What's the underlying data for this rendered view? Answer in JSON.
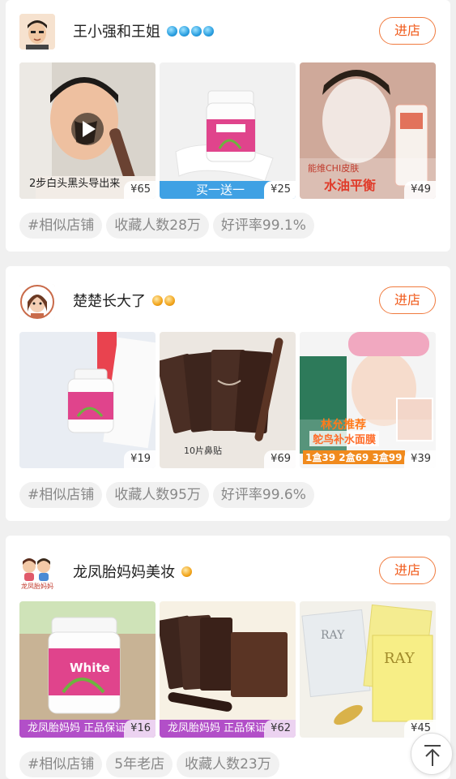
{
  "shops": [
    {
      "name": "王小强和王姐",
      "badge_type": "crown-blue",
      "badge_count": 4,
      "enter_label": "进店",
      "products": [
        {
          "price": "¥65",
          "caption": "2步白头黑头导出来"
        },
        {
          "price": "¥25",
          "caption": "买一送一"
        },
        {
          "price": "¥49",
          "caption_top": "能维CHI皮肤",
          "caption": "水油平衡"
        }
      ],
      "tags": [
        "#相似店铺",
        "收藏人数28万",
        "好评率99.1%"
      ]
    },
    {
      "name": "楚楚长大了",
      "badge_type": "crown-gold",
      "badge_count": 2,
      "enter_label": "进店",
      "products": [
        {
          "price": "¥19"
        },
        {
          "price": "¥69",
          "caption": "10片鼻贴"
        },
        {
          "price": "¥39",
          "caption_top": "林允推荐",
          "caption": "鸵鸟补水面膜",
          "caption_bottom": "1盒39 2盒69 3盒99"
        }
      ],
      "tags": [
        "#相似店铺",
        "收藏人数95万",
        "好评率99.6%"
      ]
    },
    {
      "name": "龙凤胎妈妈美妆",
      "badge_type": "crown-gold",
      "badge_count": 1,
      "enter_label": "进店",
      "logo_text": "龙凤胎妈妈",
      "products": [
        {
          "price": "¥16",
          "caption": "龙凤胎妈妈 正品保证"
        },
        {
          "price": "¥62",
          "caption": "龙凤胎妈妈 正品保证"
        },
        {
          "price": "¥45"
        }
      ],
      "tags": [
        "#相似店铺",
        "5年老店",
        "收藏人数23万"
      ]
    }
  ],
  "colors": {
    "accent": "#f05a1a",
    "banner_blue": "#3fa1e4",
    "banner_purple": "#b24fc8"
  },
  "back_to_top_icon": "arrow-up-icon"
}
